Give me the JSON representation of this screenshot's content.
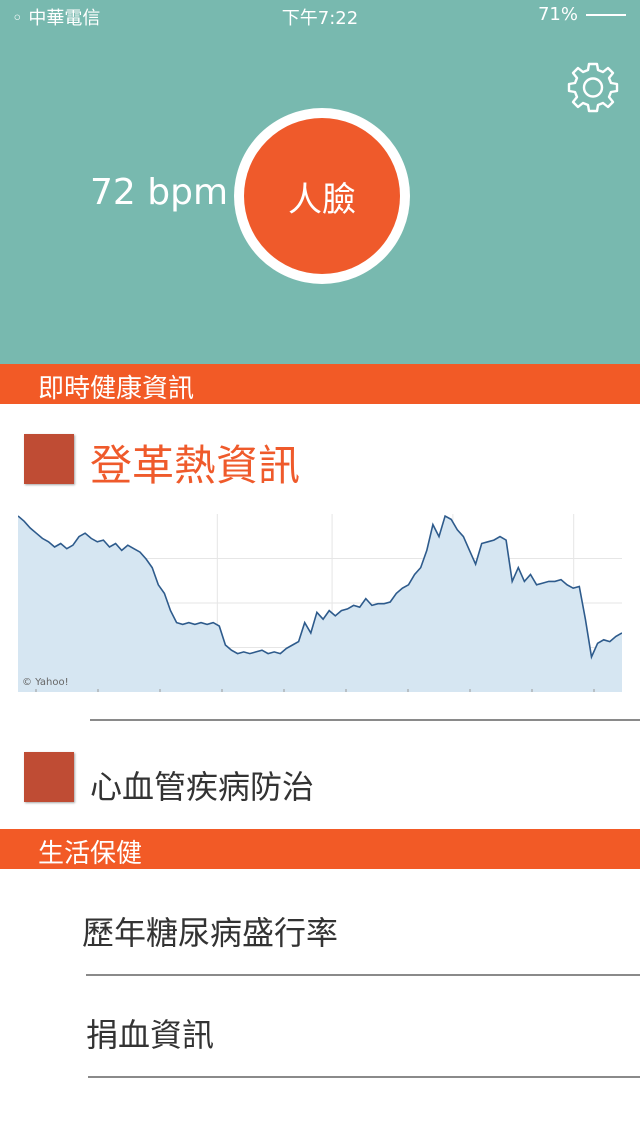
{
  "status_bar": {
    "carrier": "◦ 中華電信",
    "time": "下午7:22",
    "battery": "71%"
  },
  "header": {
    "bpm": "72 bpm",
    "face_button_label": "人臉"
  },
  "sections": [
    {
      "label": "即時健康資訊"
    },
    {
      "label": "生活保健"
    }
  ],
  "featured": {
    "title": "登革熱資訊"
  },
  "items": {
    "cardio": "心血管疾病防治",
    "diabetes": "歷年糖尿病盛行率",
    "blood": "捐血資訊"
  },
  "chart_data": {
    "type": "area",
    "watermark": "© Yahoo!",
    "fill_color": "#d6e6f2",
    "line_color": "#2e5b8c",
    "grid": true,
    "x": [
      0,
      1,
      2,
      3,
      4,
      5,
      6,
      7,
      8,
      9,
      10,
      11,
      12,
      13,
      14,
      15,
      16,
      17,
      18,
      19,
      20,
      21,
      22,
      23,
      24,
      25,
      26,
      27,
      28,
      29,
      30,
      31,
      32,
      33,
      34,
      35,
      36,
      37,
      38,
      39,
      40,
      41,
      42,
      43,
      44,
      45,
      46,
      47,
      48,
      49,
      50,
      51,
      52,
      53,
      54,
      55,
      56,
      57,
      58,
      59,
      60,
      61,
      62,
      63,
      64,
      65,
      66,
      67,
      68,
      69,
      70,
      71,
      72,
      73,
      74,
      75,
      76,
      77,
      78,
      79,
      80,
      81,
      82,
      83,
      84,
      85,
      86,
      87,
      88,
      89,
      90,
      91,
      92,
      93,
      94,
      95,
      96,
      97,
      98,
      99
    ],
    "values": [
      100,
      97,
      93,
      90,
      87,
      85,
      82,
      84,
      81,
      83,
      88,
      90,
      87,
      85,
      86,
      82,
      84,
      80,
      83,
      81,
      79,
      75,
      70,
      60,
      55,
      45,
      38,
      37,
      38,
      37,
      38,
      37,
      38,
      36,
      25,
      22,
      20,
      21,
      20,
      21,
      22,
      20,
      21,
      20,
      23,
      25,
      27,
      38,
      32,
      44,
      40,
      45,
      42,
      45,
      46,
      48,
      47,
      52,
      48,
      49,
      49,
      50,
      55,
      58,
      60,
      66,
      70,
      80,
      95,
      88,
      100,
      98,
      92,
      88,
      80,
      72,
      84,
      85,
      86,
      88,
      86,
      62,
      70,
      62,
      66,
      60,
      61,
      62,
      62,
      63,
      60,
      58,
      59,
      40,
      18,
      26,
      28,
      27,
      30,
      32
    ],
    "ylim": [
      0,
      100
    ]
  }
}
